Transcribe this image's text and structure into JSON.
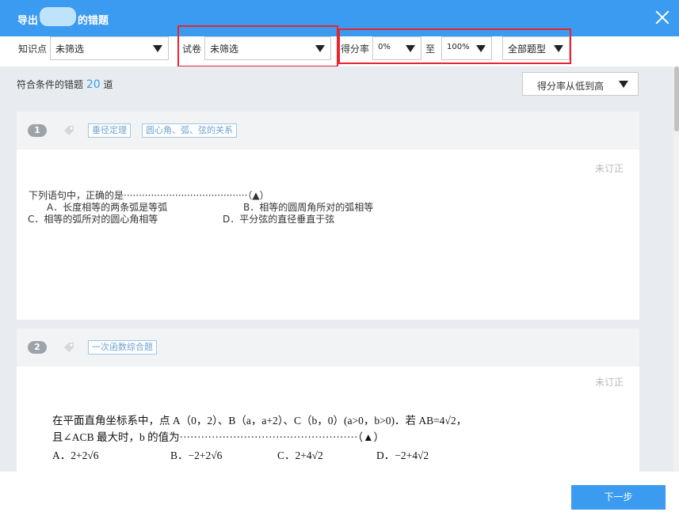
{
  "dialog": {
    "title_prefix": "导出",
    "title_suffix": "的错题"
  },
  "filters": {
    "knowledge_label": "知识点",
    "knowledge_value": "未筛选",
    "paper_label": "试卷",
    "paper_value": "未筛选",
    "score_label": "得分率",
    "score_from": "0%",
    "score_to_label": "至",
    "score_to": "100%",
    "type_value": "全部题型"
  },
  "summary": {
    "prefix": "符合条件的错题",
    "count": "20",
    "suffix": "道",
    "sort_value": "得分率从低到高"
  },
  "questions": [
    {
      "number": "1",
      "tags": [
        "垂径定理",
        "圆心角、弧、弦的关系"
      ],
      "status": "未订正",
      "stem": "下列语句中，正确的是·········································（▲）",
      "option_a": "A．长度相等的两条弧是等弧",
      "option_b": "B．相等的圆周角所对的弧相等",
      "option_c": "C．相等的弧所对的圆心角相等",
      "option_d": "D．平分弦的直径垂直于弦"
    },
    {
      "number": "2",
      "tags": [
        "一次函数综合题"
      ],
      "status": "未订正",
      "stem_line1": "在平面直角坐标系中，点 A（0，2）、B（a，a+2）、C（b，0）(a>0，b>0)．若 AB=4√2，",
      "stem_line2": "且∠ACB 最大时，b 的值为··················································（▲）",
      "option_a": "A．2+2√6",
      "option_b": "B．−2+2√6",
      "option_c": "C．2+4√2",
      "option_d": "D．−2+4√2"
    }
  ],
  "footer": {
    "next_label": "下一步"
  },
  "colors": {
    "accent": "#3a9bf0",
    "highlight_box": "#e5262d",
    "tag_border": "#9ec6e6"
  }
}
